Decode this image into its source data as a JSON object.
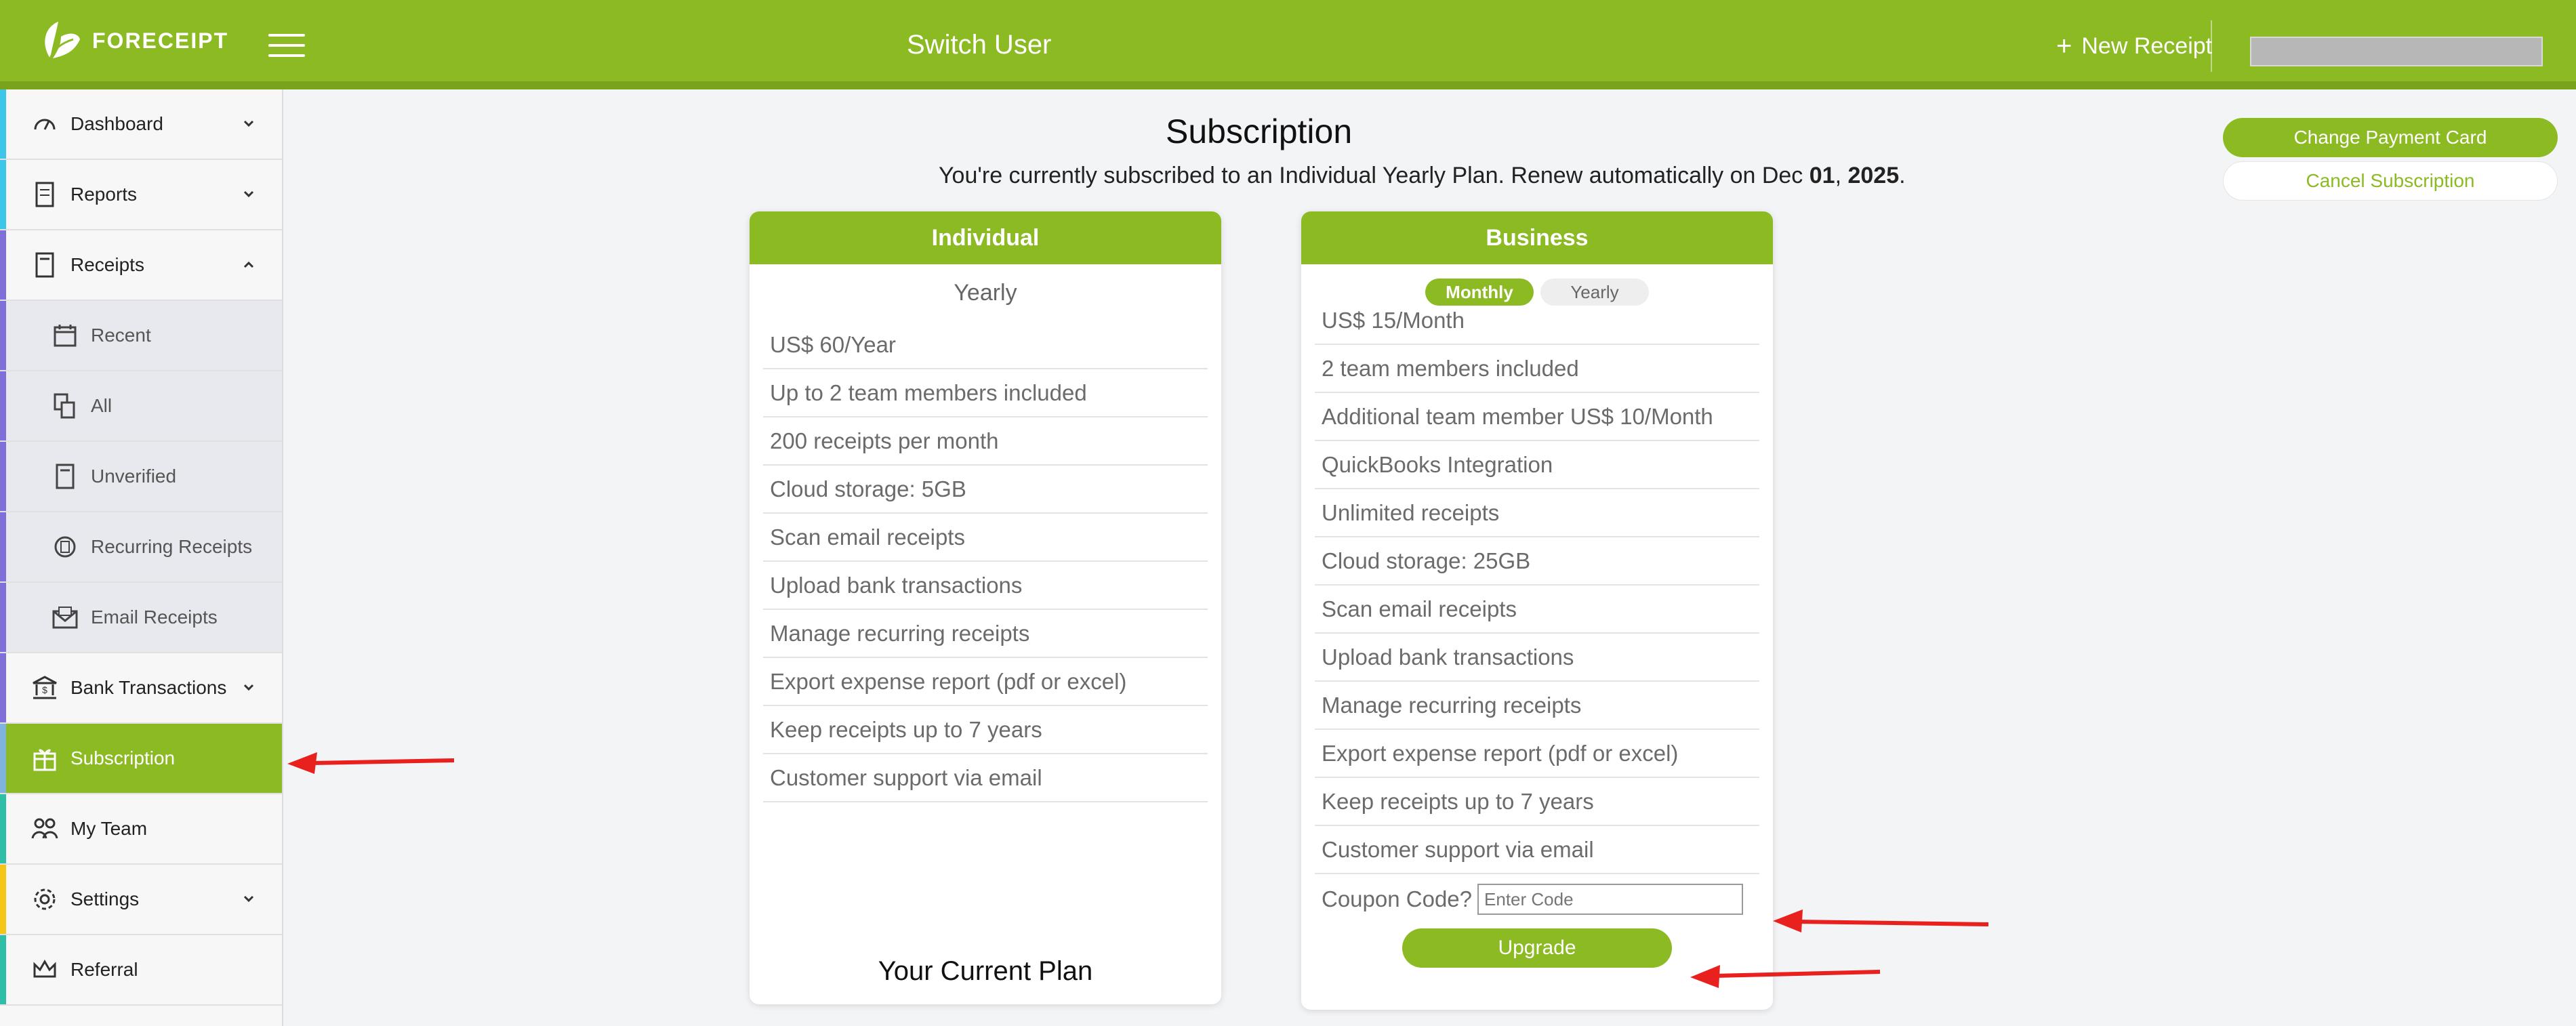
{
  "header": {
    "brand": "FORECEIPT",
    "switch_user": "Switch User",
    "new_receipt": "New Receipt",
    "accent": "#8cba23"
  },
  "sidebar": {
    "items": [
      {
        "label": "Dashboard",
        "icon": "gauge-icon"
      },
      {
        "label": "Reports",
        "icon": "report-icon"
      },
      {
        "label": "Receipts",
        "icon": "receipt-icon"
      },
      {
        "label": "Recent",
        "icon": "calendar-icon"
      },
      {
        "label": "All",
        "icon": "receipt-stack-icon"
      },
      {
        "label": "Unverified",
        "icon": "receipt-icon"
      },
      {
        "label": "Recurring Receipts",
        "icon": "recurring-icon"
      },
      {
        "label": "Email Receipts",
        "icon": "envelope-icon"
      },
      {
        "label": "Bank Transactions",
        "icon": "bank-icon"
      },
      {
        "label": "Subscription",
        "icon": "gift-icon"
      },
      {
        "label": "My Team",
        "icon": "team-icon"
      },
      {
        "label": "Settings",
        "icon": "gear-icon"
      },
      {
        "label": "Referral",
        "icon": "crown-icon"
      }
    ]
  },
  "main": {
    "title": "Subscription",
    "status_prefix": "You're currently subscribed to an Individual Yearly Plan. Renew automatically on Dec ",
    "status_day": "01",
    "status_comma": ", ",
    "status_year": "2025",
    "status_end": ".",
    "change_card": "Change Payment Card",
    "cancel_subscription": "Cancel Subscription"
  },
  "individual": {
    "name": "Individual",
    "period": "Yearly",
    "features": [
      "US$ 60/Year",
      "Up to 2 team members included",
      "200 receipts per month",
      "Cloud storage: 5GB",
      "Scan email receipts",
      "Upload bank transactions",
      "Manage recurring receipts",
      "Export expense report (pdf or excel)",
      "Keep receipts up to 7 years",
      "Customer support via email"
    ],
    "current_plan": "Your Current Plan"
  },
  "business": {
    "name": "Business",
    "toggle_monthly": "Monthly",
    "toggle_yearly": "Yearly",
    "features": [
      "US$ 15/Month",
      "2 team members included",
      "Additional team member US$ 10/Month",
      "QuickBooks Integration",
      "Unlimited receipts",
      "Cloud storage: 25GB",
      "Scan email receipts",
      "Upload bank transactions",
      "Manage recurring receipts",
      "Export expense report (pdf or excel)",
      "Keep receipts up to 7 years",
      "Customer support via email"
    ],
    "coupon_label": "Coupon Code?",
    "coupon_placeholder": "Enter Code",
    "upgrade": "Upgrade"
  }
}
